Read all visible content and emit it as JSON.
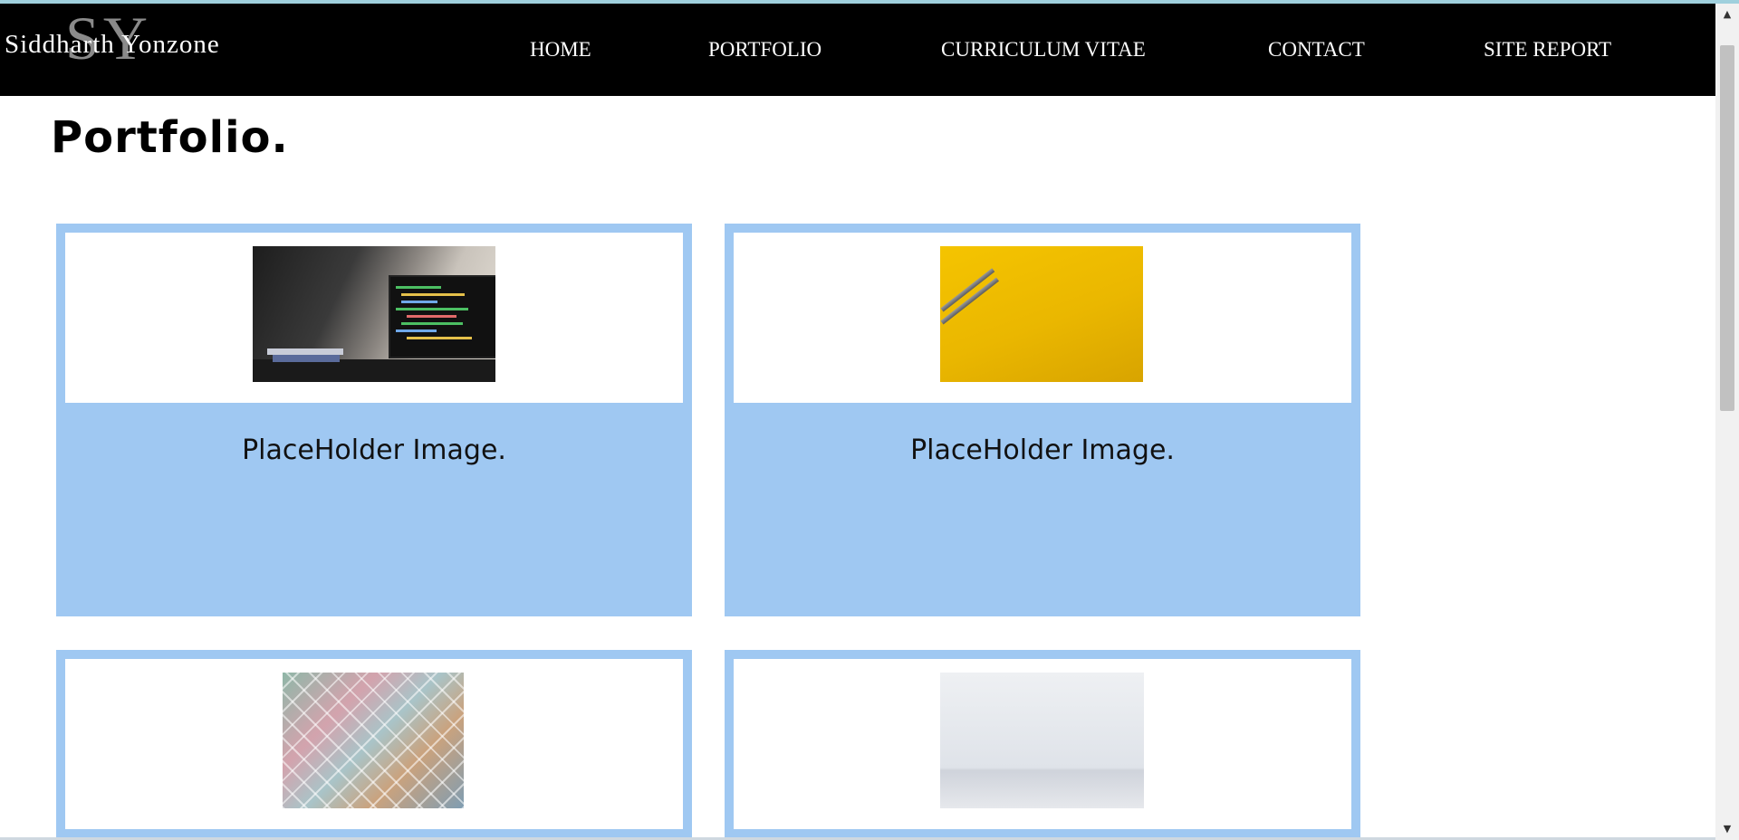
{
  "brand": {
    "monogram": "SY",
    "name": "Siddharth Yonzone"
  },
  "nav": {
    "items": [
      {
        "label": "HOME"
      },
      {
        "label": "PORTFOLIO"
      },
      {
        "label": "CURRICULUM VITAE"
      },
      {
        "label": "CONTACT"
      },
      {
        "label": "SITE REPORT"
      }
    ]
  },
  "page": {
    "title": "Portfolio."
  },
  "cards": [
    {
      "caption": "PlaceHolder Image.",
      "image": "laptop-code-photo"
    },
    {
      "caption": "PlaceHolder Image.",
      "image": "pencils-on-yellow-photo"
    },
    {
      "caption": "",
      "image": "colorful-tiles-photo"
    },
    {
      "caption": "",
      "image": "white-paper-photo"
    }
  ],
  "colors": {
    "navbar": "#000000",
    "card_border": "#9fc8f2",
    "text": "#000000"
  }
}
